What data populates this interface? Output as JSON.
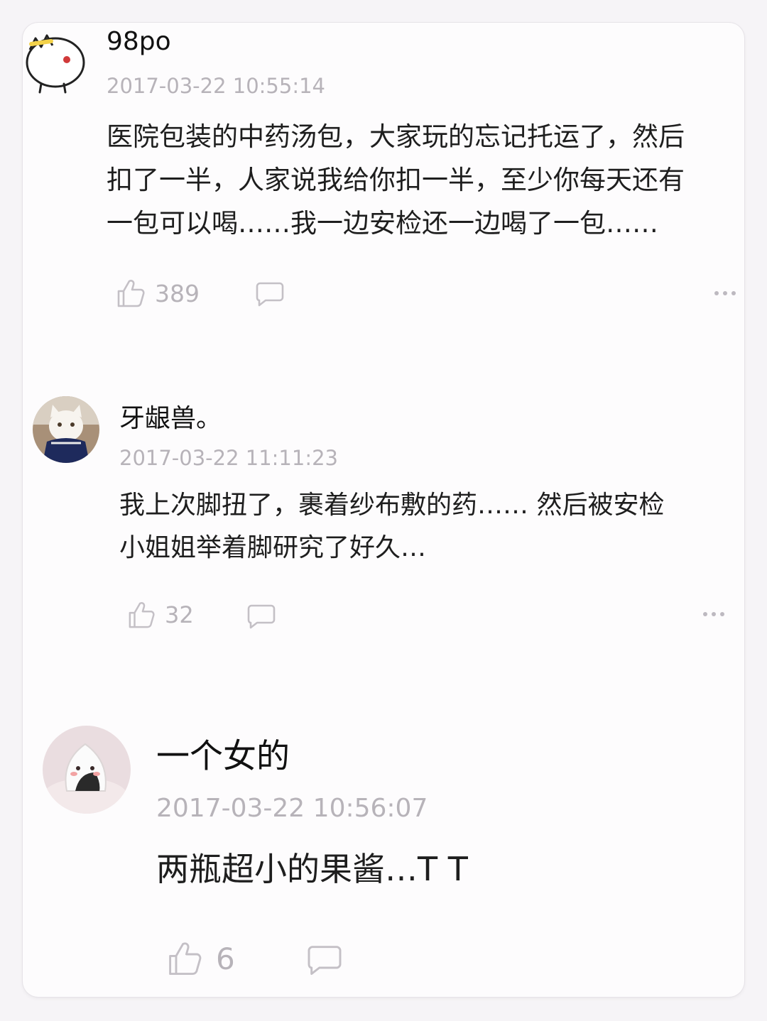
{
  "comments": [
    {
      "username": "98po",
      "timestamp": "2017-03-22 10:55:14",
      "text": "医院包装的中药汤包，大家玩的忘记托运了，然后\n扣了一半，人家说我给你扣一半，至少你每天还有\n一包可以喝……我一边安检还一边喝了一包……",
      "likes": "389",
      "avatar_icon": "cartoon-bird-avatar"
    },
    {
      "username": "牙龈兽。",
      "timestamp": "2017-03-22 11:11:23",
      "text": "我上次脚扭了，裹着纱布敷的药…… 然后被安检\n小姐姐举着脚研究了好久…",
      "likes": "32",
      "avatar_icon": "white-cat-avatar"
    },
    {
      "username": "一个女的",
      "timestamp": "2017-03-22 10:56:07",
      "text": "两瓶超小的果酱…T T",
      "likes": "6",
      "avatar_icon": "rice-ball-avatar"
    }
  ],
  "icons": {
    "like": "thumbs-up-icon",
    "reply": "speech-bubble-icon",
    "more": "more-dots-icon"
  },
  "colors": {
    "background": "#f6f4f7",
    "card": "#fdfcfd",
    "text": "#1e1e1e",
    "muted": "#b7b3b9"
  }
}
